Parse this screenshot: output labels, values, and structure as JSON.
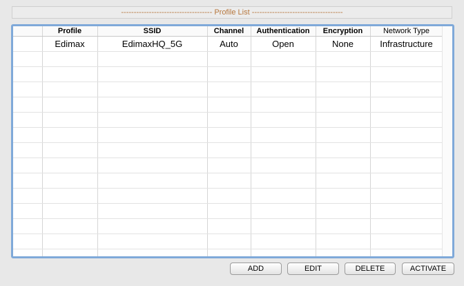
{
  "title": "------------------------------------ Profile List ------------------------------------",
  "columns": [
    "",
    "Profile",
    "SSID",
    "Channel",
    "Authentication",
    "Encryption",
    "Network Type"
  ],
  "rows": [
    [
      "",
      "Edimax",
      "EdimaxHQ_5G",
      "Auto",
      "Open",
      "None",
      "Infrastructure"
    ]
  ],
  "buttons": {
    "add": "ADD",
    "edit": "EDIT",
    "delete": "DELETE",
    "activate": "ACTIVATE"
  }
}
